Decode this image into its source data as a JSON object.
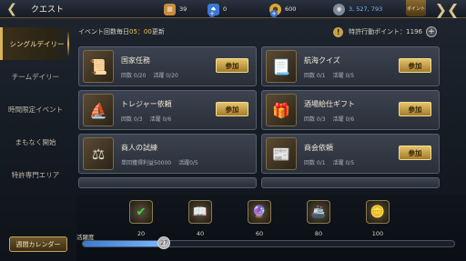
{
  "topbar": {
    "title": "クエスト",
    "resources": [
      {
        "name": "chest-icon",
        "value": "39",
        "color": "#c98a3a"
      },
      {
        "name": "blue-gem-icon",
        "value": "0",
        "color": "#3a78d8"
      },
      {
        "name": "coin-icon",
        "value": "600",
        "color": "#d8a83a"
      },
      {
        "name": "silver-coin-icon",
        "value": "3, 527, 793",
        "color": "#7a8a9a"
      }
    ],
    "point_tab": "ポイント"
  },
  "sidebar": {
    "items": [
      {
        "label": "シングルデイリー",
        "active": true
      },
      {
        "label": "チームデイリー",
        "active": false
      },
      {
        "label": "時間限定イベント",
        "active": false
      },
      {
        "label": "まもなく開始",
        "active": false
      },
      {
        "label": "特許専門エリア",
        "active": false
      }
    ],
    "calendar_button": "週間カレンダー"
  },
  "panel": {
    "info_prefix": "イベント回数毎日",
    "info_time": "05：00",
    "info_suffix": "更新",
    "points_label": "特許行動ポイント：1196",
    "join_label": "参加",
    "cards": [
      {
        "name": "国家任務",
        "stat1": "回数 0/20",
        "stat2": "活躍 0/20",
        "icon": "scroll-map-icon",
        "join": true
      },
      {
        "name": "航海クイズ",
        "stat1": "回数 0/1",
        "stat2": "活躍 0/5",
        "icon": "quiz-scroll-icon",
        "join": true
      },
      {
        "name": "トレジャー依頼",
        "stat1": "回数 0/3",
        "stat2": "活躍 0/6",
        "icon": "treasure-ship-icon",
        "join": true
      },
      {
        "name": "酒場給仕ギフト",
        "stat1": "回数 0/3",
        "stat2": "活躍 0/6",
        "icon": "gift-box-icon",
        "join": true
      },
      {
        "name": "商人の試練",
        "stat1": "単回獲得利益50000",
        "stat2": "活躍0/5",
        "icon": "merchant-scale-icon",
        "join": false
      },
      {
        "name": "商会依頼",
        "stat1": "回数 0/1",
        "stat2": "活躍 0/5",
        "icon": "guild-document-icon",
        "join": true
      }
    ]
  },
  "rewards": {
    "label": "活躍度",
    "progress_fraction": 0.22,
    "knob_value": "27",
    "items": [
      {
        "value": "20",
        "icon": "green-check-icon",
        "claimed": true
      },
      {
        "value": "40",
        "icon": "book-icon",
        "claimed": false
      },
      {
        "value": "60",
        "icon": "crystal-ball-icon",
        "claimed": false
      },
      {
        "value": "80",
        "icon": "ship-icon",
        "claimed": false
      },
      {
        "value": "100",
        "icon": "gold-coin-icon",
        "claimed": false
      }
    ]
  }
}
